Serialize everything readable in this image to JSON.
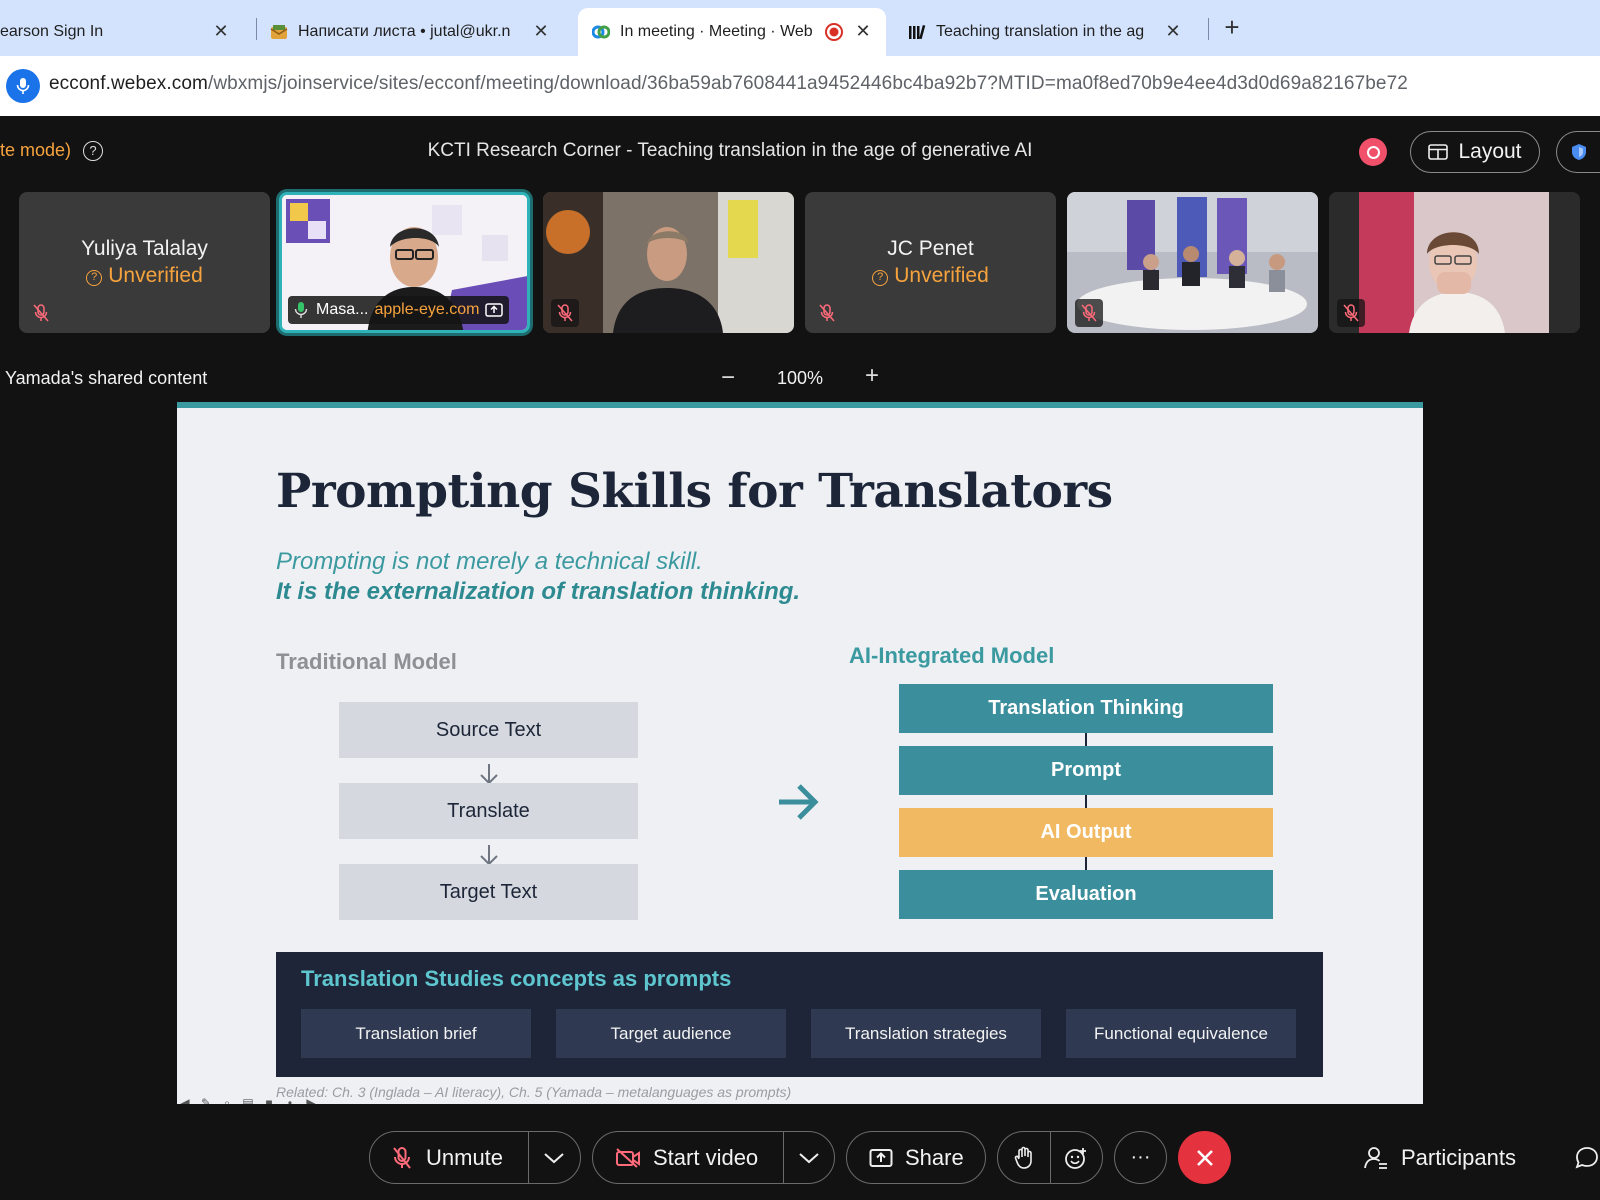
{
  "browser": {
    "tabs": [
      {
        "label": "earson Sign In",
        "close": "✕"
      },
      {
        "label": "Написати листа • jutal@ukr.n",
        "close": "✕"
      },
      {
        "label": "In meeting · Meeting · Web",
        "close": "✕"
      },
      {
        "label": "Teaching translation in the ag",
        "close": "✕"
      }
    ],
    "new_tab": "+",
    "url_host": "ecconf.webex.com",
    "url_path": "/wbxmjs/joinservice/sites/ecconf/meeting/download/36ba59ab7608441a9452446bc4ba92b7?MTID=ma0f8ed70b9e4ee4d3d0d69a82167be72"
  },
  "meeting": {
    "mode_text": "te mode)",
    "help_glyph": "?",
    "title": "KCTI Research Corner - Teaching translation in the age of generative AI",
    "layout_label": "Layout",
    "record_color": "#f0506a",
    "accent": "#2fb3b8"
  },
  "participants": [
    {
      "name": "Yuliya Talalay",
      "status": "Unverified",
      "status_glyph": "?"
    },
    {
      "name": "Masa...",
      "host": "apple-eye.com"
    },
    {
      "name": ""
    },
    {
      "name": "JC Penet",
      "status": "Unverified",
      "status_glyph": "?"
    },
    {
      "name": ""
    },
    {
      "name": ""
    }
  ],
  "share": {
    "label": "Yamada's shared content",
    "zoom_minus": "−",
    "zoom": "100%",
    "zoom_plus": "+"
  },
  "slide": {
    "title": "Prompting Skills for Translators",
    "subtitle1": "Prompting is not merely a technical skill.",
    "subtitle2": "It is the externalization of translation thinking.",
    "traditional": {
      "title": "Traditional Model",
      "steps": [
        "Source Text",
        "Translate",
        "Target Text"
      ]
    },
    "ai": {
      "title": "AI-Integrated Model",
      "steps": [
        "Translation Thinking",
        "Prompt",
        "AI Output",
        "Evaluation"
      ]
    },
    "concepts": {
      "title": "Translation Studies concepts as prompts",
      "chips": [
        "Translation brief",
        "Target audience",
        "Translation strategies",
        "Functional equivalence"
      ]
    },
    "related": "Related: Ch. 3 (Inglada – AI literacy), Ch. 5 (Yamada – metalanguages as prompts)",
    "colors": {
      "teal": "#3b8e9b",
      "orange": "#f2b963",
      "navy": "#1e2538"
    }
  },
  "controls": {
    "unmute": "Unmute",
    "start_video": "Start video",
    "share": "Share",
    "more": "···",
    "participants": "Participants"
  },
  "icons": [
    "mic-icon",
    "close-icon",
    "help-icon",
    "record-icon",
    "layout-icon",
    "shield-icon",
    "mic-muted-icon",
    "share-screen-icon",
    "chevron-down-icon",
    "video-off-icon",
    "raise-hand-icon",
    "reactions-icon",
    "end-call-icon",
    "participants-icon",
    "chat-icon",
    "arrow-right-icon",
    "arrow-down-icon"
  ]
}
